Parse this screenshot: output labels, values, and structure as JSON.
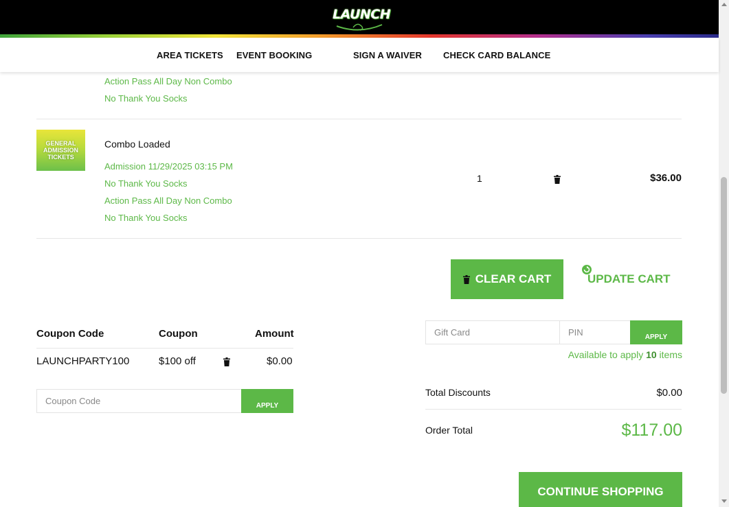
{
  "header": {
    "logo_text": "LAUNCH",
    "nav": [
      "AREA TICKETS",
      "EVENT BOOKING",
      "SIGN A WAIVER",
      "CHECK CARD BALANCE"
    ]
  },
  "cart": {
    "prev_item_options": [
      "Action Pass All Day Non Combo",
      "No Thank You Socks"
    ],
    "item": {
      "thumb_text": "GENERAL ADMISSION TICKETS",
      "name": "Combo Loaded",
      "options": [
        "Admission 11/29/2025 03:15 PM",
        "No Thank You Socks",
        "Action Pass All Day Non Combo",
        "No Thank You Socks"
      ],
      "qty": "1",
      "price": "$36.00"
    },
    "clear_cart_label": "CLEAR CART",
    "update_cart_label": "UPDATE CART"
  },
  "coupons": {
    "headers": [
      "Coupon Code",
      "Coupon",
      "Amount"
    ],
    "row": {
      "code": "LAUNCHPARTY100",
      "coupon": "$100 off",
      "amount": "$0.00"
    },
    "input_placeholder": "Coupon Code",
    "apply_label": "APPLY"
  },
  "gift_card": {
    "card_placeholder": "Gift Card",
    "pin_placeholder": "PIN",
    "apply_label": "APPLY",
    "available_prefix": "Available to apply",
    "available_count": "10",
    "available_suffix": "items"
  },
  "totals": {
    "discounts_label": "Total Discounts",
    "discounts_value": "$0.00",
    "order_total_label": "Order Total",
    "order_total_value": "$117.00"
  },
  "continue_label": "CONTINUE SHOPPING",
  "colors": {
    "accent_green": "#5cb847",
    "header_bg": "#000000"
  }
}
